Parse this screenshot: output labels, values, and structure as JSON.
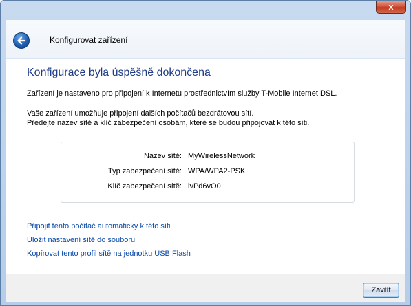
{
  "window": {
    "close_glyph": "x"
  },
  "header": {
    "title": "Konfigurovat zařízení"
  },
  "main": {
    "heading": "Konfigurace byla úspěšně dokončena",
    "paragraph1": "Zařízení je nastaveno pro připojení k Internetu prostřednictvím služby T-Mobile Internet DSL.",
    "paragraph2_line1": "Vaše zařízení umožňuje připojení dalších počítačů bezdrátovou sítí.",
    "paragraph2_line2": "Předejte název sítě a klíč zabezpečení osobám, které se budou připojovat k této síti.",
    "info": [
      {
        "label": "Název sítě:",
        "value": "MyWirelessNetwork"
      },
      {
        "label": "Typ zabezpečení sítě:",
        "value": "WPA/WPA2-PSK"
      },
      {
        "label": "Klíč zabezpečení sítě:",
        "value": "ivPd6vO0"
      }
    ],
    "links": [
      "Připojit tento počítač automaticky k této síti",
      "Uložit nastavení sítě do souboru",
      "Kopírovat tento profil sítě na jednotku USB Flash"
    ]
  },
  "footer": {
    "close_label": "Zavřít"
  },
  "colors": {
    "heading": "#1f3d86",
    "link": "#0b4aa8",
    "accent": "#3c7fb1"
  }
}
